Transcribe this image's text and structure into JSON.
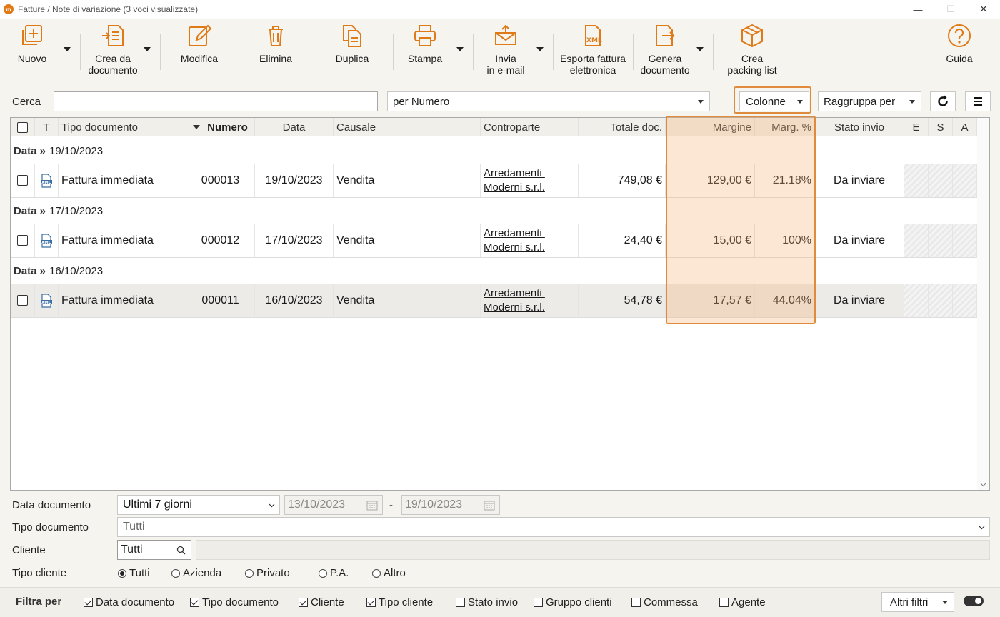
{
  "window": {
    "title": "Fatture / Note di variazione (3 voci visualizzate)",
    "minimize": "—",
    "maximize": "☐",
    "close": "✕"
  },
  "toolbar": {
    "nuovo": "Nuovo",
    "crea_da_1": "Crea da",
    "crea_da_2": "documento",
    "modifica": "Modifica",
    "elimina": "Elimina",
    "duplica": "Duplica",
    "stampa": "Stampa",
    "invia_1": "Invia",
    "invia_2": "in e-mail",
    "esporta_1": "Esporta fattura",
    "esporta_2": "elettronica",
    "genera_1": "Genera",
    "genera_2": "documento",
    "packing_1": "Crea",
    "packing_2": "packing list",
    "guida": "Guida",
    "accent": "#e07a17"
  },
  "search": {
    "label": "Cerca",
    "value": "",
    "by": "per Numero",
    "columns": "Colonne",
    "group_by": "Raggruppa per"
  },
  "grid": {
    "headers": {
      "t": "T",
      "tipo": "Tipo documento",
      "numero": "Numero",
      "data": "Data",
      "causale": "Causale",
      "controparte": "Controparte",
      "totale": "Totale doc.",
      "margine": "Margine",
      "marg_pct": "Marg. %",
      "stato": "Stato invio",
      "e": "E",
      "s": "S",
      "a": "A"
    },
    "group_label": "Data »",
    "groups": [
      {
        "date": "19/10/2023",
        "row": {
          "tipo": "Fattura immediata",
          "numero": "000013",
          "data": "19/10/2023",
          "causale": "Vendita",
          "controparte_1": "Arredamenti ",
          "controparte_2": "Moderni s.r.l.",
          "totale": "749,08 €",
          "margine": "129,00 €",
          "marg_pct": "21.18%",
          "stato": "Da inviare"
        }
      },
      {
        "date": "17/10/2023",
        "row": {
          "tipo": "Fattura immediata",
          "numero": "000012",
          "data": "17/10/2023",
          "causale": "Vendita",
          "controparte_1": "Arredamenti ",
          "controparte_2": "Moderni s.r.l.",
          "totale": "24,40 €",
          "margine": "15,00 €",
          "marg_pct": "100%",
          "stato": "Da inviare"
        }
      },
      {
        "date": "16/10/2023",
        "row": {
          "tipo": "Fattura immediata",
          "numero": "000011",
          "data": "16/10/2023",
          "causale": "Vendita",
          "controparte_1": "Arredamenti ",
          "controparte_2": "Moderni s.r.l.",
          "totale": "54,78 €",
          "margine": "17,57 €",
          "marg_pct": "44.04%",
          "stato": "Da inviare"
        }
      }
    ]
  },
  "filters": {
    "data_documento_label": "Data documento",
    "data_documento_value": "Ultimi 7 giorni",
    "date_from": "13/10/2023",
    "date_sep": "-",
    "date_to": "19/10/2023",
    "tipo_documento_label": "Tipo documento",
    "tipo_documento_value": "Tutti",
    "cliente_label": "Cliente",
    "cliente_value": "Tutti",
    "tipo_cliente_label": "Tipo cliente",
    "radio_tutti": "Tutti",
    "radio_azienda": "Azienda",
    "radio_privato": "Privato",
    "radio_pa": "P.A.",
    "radio_altro": "Altro"
  },
  "filterbar": {
    "label": "Filtra per",
    "data_documento": "Data documento",
    "tipo_documento": "Tipo documento",
    "cliente": "Cliente",
    "tipo_cliente": "Tipo cliente",
    "stato_invio": "Stato invio",
    "gruppo_clienti": "Gruppo clienti",
    "commessa": "Commessa",
    "agente": "Agente",
    "altri_filtri": "Altri filtri"
  }
}
